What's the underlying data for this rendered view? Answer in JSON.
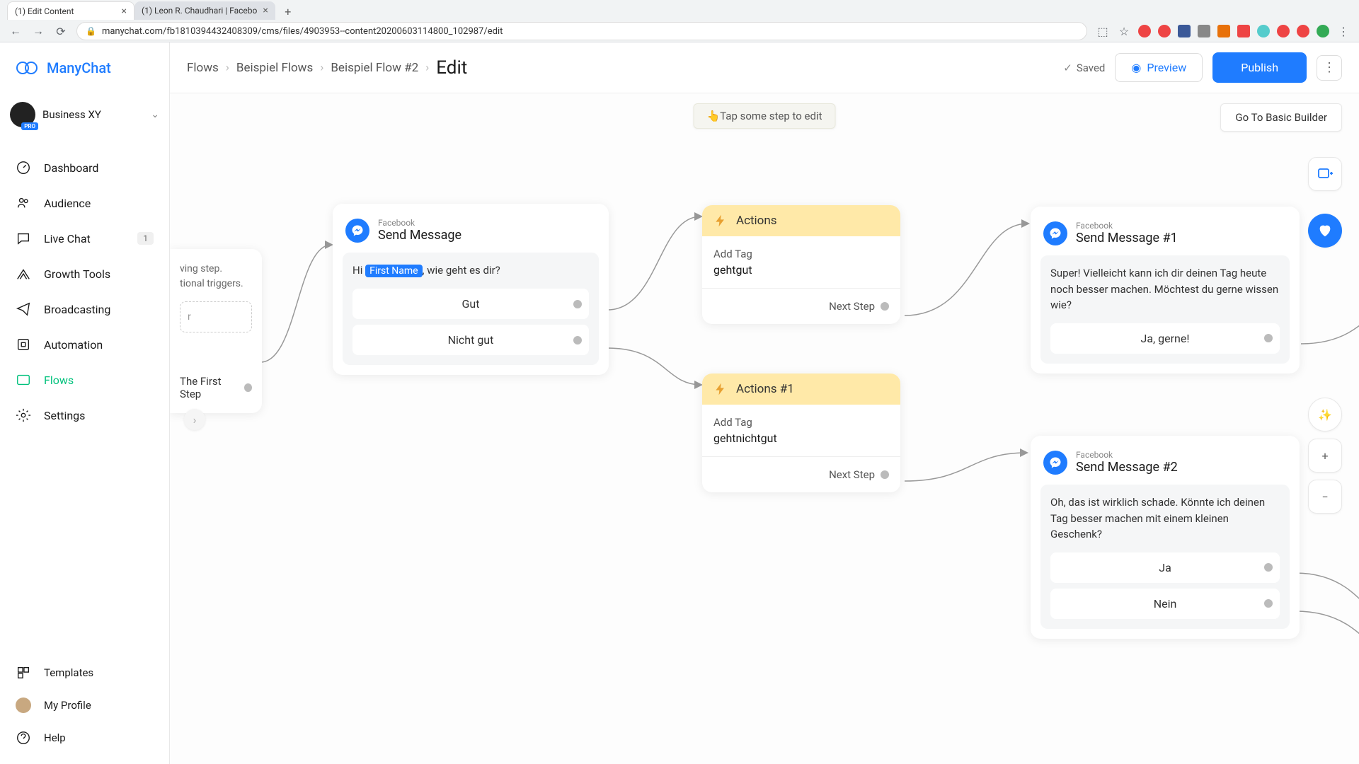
{
  "browser": {
    "tabs": [
      {
        "title": "(1) Edit Content",
        "active": true
      },
      {
        "title": "(1) Leon R. Chaudhari | Facebo",
        "active": false
      }
    ],
    "url": "manychat.com/fb181039443240830​9/cms/files/4903953--content20200603114800_102987/edit"
  },
  "logo": "ManyChat",
  "account": {
    "name": "Business XY",
    "badge": "PRO"
  },
  "nav": {
    "dashboard": "Dashboard",
    "audience": "Audience",
    "livechat": "Live Chat",
    "livechat_badge": "1",
    "growth": "Growth Tools",
    "broadcasting": "Broadcasting",
    "automation": "Automation",
    "flows": "Flows",
    "settings": "Settings",
    "templates": "Templates",
    "profile": "My Profile",
    "help": "Help"
  },
  "topbar": {
    "crumbs": [
      "Flows",
      "Beispiel Flows",
      "Beispiel Flow #2"
    ],
    "current": "Edit",
    "saved": "Saved",
    "preview": "Preview",
    "publish": "Publish"
  },
  "hint": "👆Tap some step to edit",
  "basic_builder": "Go To Basic Builder",
  "start_node": {
    "line1": "ving step.",
    "line2": "tional triggers.",
    "dashed": "r",
    "first_step": "The First Step"
  },
  "send_msg": {
    "subtitle": "Facebook",
    "title": "Send Message",
    "prefix": "Hi ",
    "var": "First Name",
    "suffix": ", wie geht es dir?",
    "btn1": "Gut",
    "btn2": "Nicht gut"
  },
  "actions1": {
    "title": "Actions",
    "label": "Add Tag",
    "value": "gehtgut",
    "next": "Next Step"
  },
  "actions2": {
    "title": "Actions #1",
    "label": "Add Tag",
    "value": "gehtnichtgut",
    "next": "Next Step"
  },
  "send_msg1": {
    "subtitle": "Facebook",
    "title": "Send Message #1",
    "text": "Super! Vielleicht kann ich dir deinen Tag heute noch besser machen. Möchtest du gerne wissen wie?",
    "btn1": "Ja, gerne!"
  },
  "send_msg2": {
    "subtitle": "Facebook",
    "title": "Send Message #2",
    "text": "Oh, das ist wirklich schade. Könnte ich deinen Tag besser machen mit einem kleinen Geschenk?",
    "btn1": "Ja",
    "btn2": "Nein"
  }
}
